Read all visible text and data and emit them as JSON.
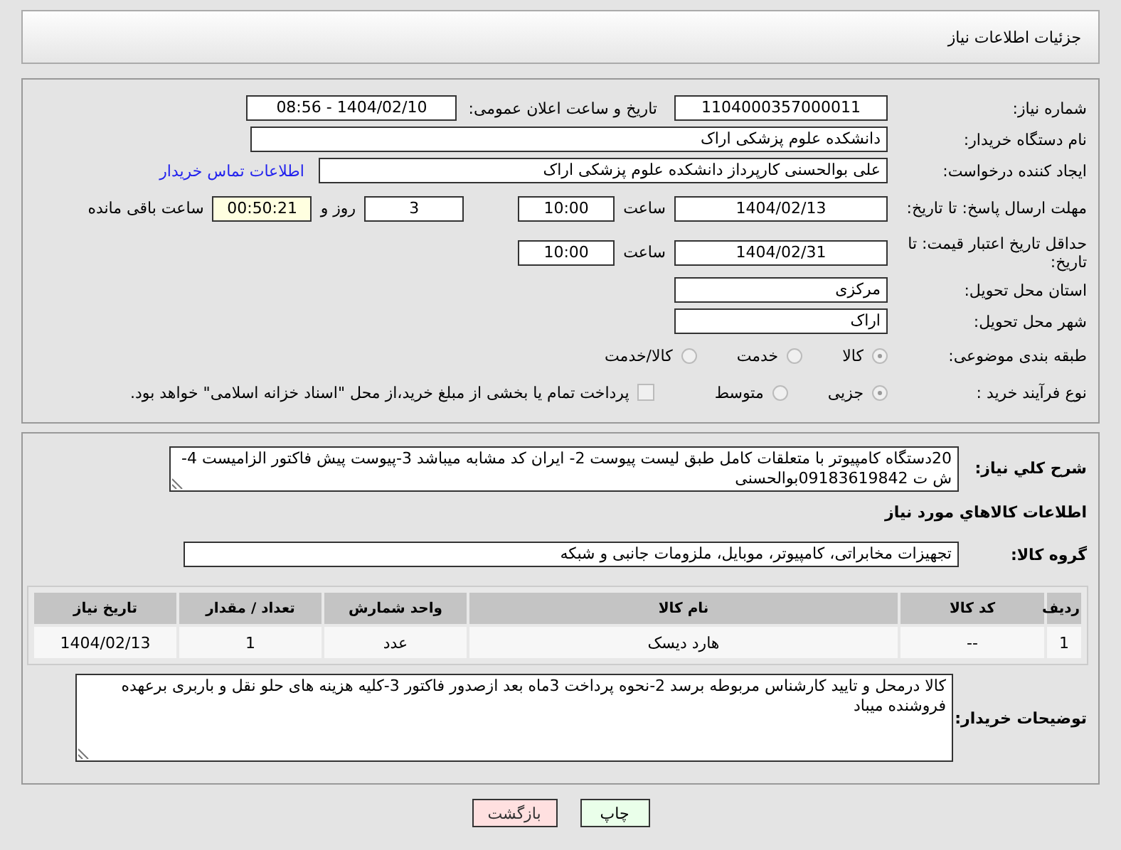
{
  "header": {
    "title": "جزئیات اطلاعات نیاز"
  },
  "need_number": {
    "label": "شماره نیاز:",
    "value": "1104000357000011"
  },
  "announce": {
    "label": "تاریخ و ساعت اعلان عمومی:",
    "value": "1404/02/10 - 08:56"
  },
  "buyer_org": {
    "label": "نام دستگاه خریدار:",
    "value": "دانشکده علوم پزشکی اراک"
  },
  "requester": {
    "label": "ایجاد کننده درخواست:",
    "value": "علی بوالحسنی کارپرداز دانشکده علوم پزشکی اراک",
    "link": "اطلاعات تماس خریدار"
  },
  "deadline": {
    "label": "مهلت ارسال پاسخ: تا تاریخ:",
    "date": "1404/02/13",
    "time_label": "ساعت",
    "time": "10:00",
    "days": "3",
    "days_label": "روز و",
    "remaining": "00:50:21",
    "remaining_label": "ساعت باقی مانده"
  },
  "validity": {
    "label": "حداقل تاریخ اعتبار قیمت: تا تاریخ:",
    "date": "1404/02/31",
    "time_label": "ساعت",
    "time": "10:00"
  },
  "province": {
    "label": "استان محل تحویل:",
    "value": "مرکزی"
  },
  "city": {
    "label": "شهر محل تحویل:",
    "value": "اراک"
  },
  "category": {
    "label": "طبقه بندی موضوعی:",
    "options": [
      {
        "label": "کالا",
        "selected": true
      },
      {
        "label": "خدمت",
        "selected": false
      },
      {
        "label": "کالا/خدمت",
        "selected": false
      }
    ]
  },
  "purchase_type": {
    "label": "نوع فرآیند خرید :",
    "options": [
      {
        "label": "جزیی",
        "selected": true
      },
      {
        "label": "متوسط",
        "selected": false
      }
    ],
    "payment": {
      "label": "پرداخت تمام یا بخشی از مبلغ خرید،از محل \"اسناد خزانه اسلامی\" خواهد بود.",
      "checked": false
    }
  },
  "description": {
    "label": "شرح کلي نياز:",
    "text": "20دستگاه کامپیوتر با متعلقات کامل طبق لیست پیوست 2- ایران کد مشابه میباشد 3-پیوست پیش فاکتور الزامیست 4-ش ت 09183619842بوالحسنی"
  },
  "goods_heading": "اطلاعات كالاهاي مورد نياز",
  "goods_group": {
    "label": "گروه کالا:",
    "value": "تجهیزات مخابراتی، کامپیوتر، موبایل، ملزومات جانبی و شبکه"
  },
  "table": {
    "columns": [
      "ردیف",
      "کد کالا",
      "نام کالا",
      "واحد شمارش",
      "تعداد / مقدار",
      "تاریخ نیاز"
    ],
    "rows": [
      [
        "1",
        "--",
        "هارد دیسک",
        "عدد",
        "1",
        "1404/02/13"
      ]
    ]
  },
  "buyer_notes": {
    "label": "توضیحات خریدار:",
    "text": "کالا درمحل و تایید کارشناس مربوطه برسد 2-نحوه پرداخت 3ماه بعد ازصدور فاکتور 3-کلیه هزینه های حلو نقل و باربری برعهده فروشنده میباد"
  },
  "buttons": [
    {
      "label": "چاپ",
      "kind": "print"
    },
    {
      "label": "بازگشت",
      "kind": "back"
    }
  ]
}
